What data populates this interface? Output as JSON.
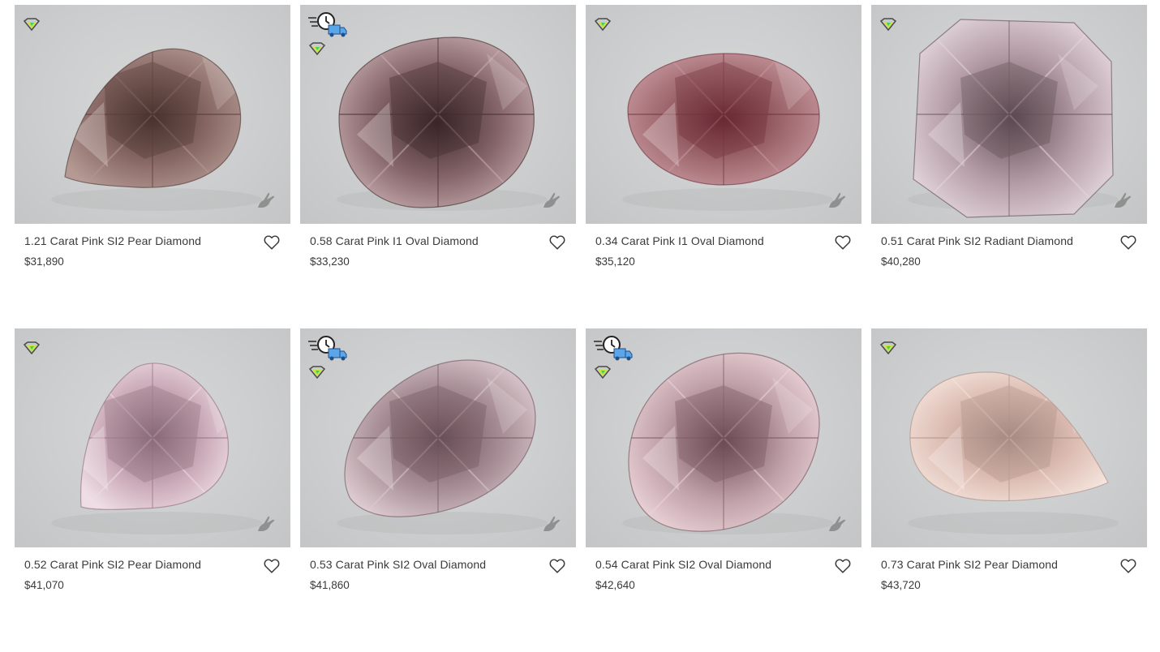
{
  "listings": [
    {
      "title": "1.21 Carat Pink SI2 Pear Diamond",
      "price": "$31,890",
      "shape": "pear",
      "fast_ship": false,
      "colors": {
        "base": "#8a6a66",
        "dark": "#4a3330",
        "light": "#b59a94"
      }
    },
    {
      "title": "0.58 Carat Pink I1 Oval Diamond",
      "price": "$33,230",
      "shape": "oval",
      "fast_ship": true,
      "colors": {
        "base": "#86666a",
        "dark": "#3a2628",
        "light": "#c9aeb2"
      }
    },
    {
      "title": "0.34 Carat Pink I1 Oval Diamond",
      "price": "$35,120",
      "shape": "oval-small",
      "fast_ship": false,
      "colors": {
        "base": "#a06a70",
        "dark": "#6a2a34",
        "light": "#c89aa0"
      }
    },
    {
      "title": "0.51 Carat Pink SI2 Radiant Diamond",
      "price": "$40,280",
      "shape": "radiant",
      "fast_ship": false,
      "colors": {
        "base": "#b49ca6",
        "dark": "#5e4a52",
        "light": "#e4d6dc"
      }
    },
    {
      "title": "0.52 Carat Pink SI2 Pear Diamond",
      "price": "$41,070",
      "shape": "pear-tall",
      "fast_ship": false,
      "colors": {
        "base": "#c9a8b6",
        "dark": "#8a6a78",
        "light": "#eedde4"
      }
    },
    {
      "title": "0.53 Carat Pink SI2 Oval Diamond",
      "price": "$41,860",
      "shape": "oval-tilt",
      "fast_ship": true,
      "colors": {
        "base": "#a88e96",
        "dark": "#6a5058",
        "light": "#dccbd0"
      }
    },
    {
      "title": "0.54 Carat Pink SI2 Oval Diamond",
      "price": "$42,640",
      "shape": "oval-tall",
      "fast_ship": true,
      "colors": {
        "base": "#c0a0a8",
        "dark": "#6e4c56",
        "light": "#ecd6da"
      }
    },
    {
      "title": "0.73 Carat Pink SI2 Pear Diamond",
      "price": "$43,720",
      "shape": "pear-side",
      "fast_ship": false,
      "colors": {
        "base": "#dcbcb2",
        "dark": "#a88c84",
        "light": "#f4e4dc"
      }
    }
  ],
  "icons": {
    "certified_badge": "diamond-badge-icon",
    "fast_shipping": "fast-shipping-icon",
    "hand_view": "hand-icon",
    "favorite": "heart-icon"
  }
}
